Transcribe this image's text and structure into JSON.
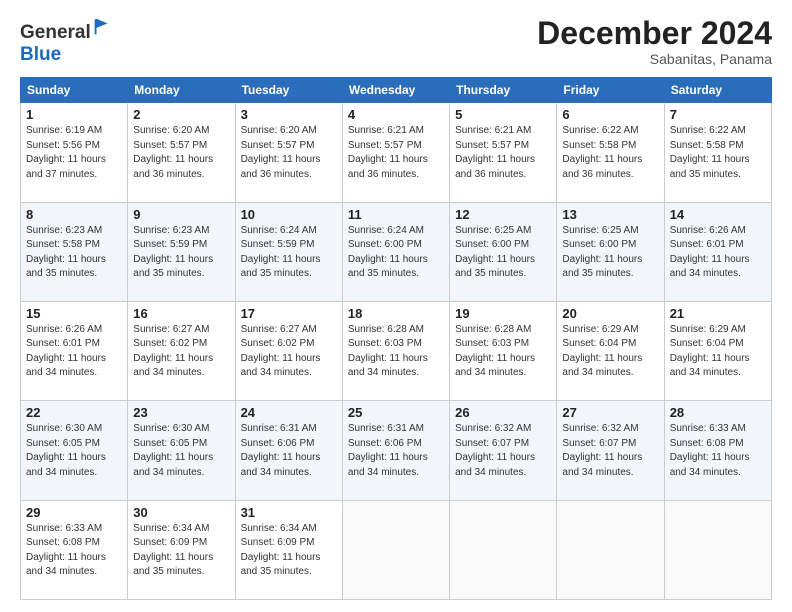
{
  "header": {
    "logo_general": "General",
    "logo_blue": "Blue",
    "month_title": "December 2024",
    "location": "Sabanitas, Panama"
  },
  "weekdays": [
    "Sunday",
    "Monday",
    "Tuesday",
    "Wednesday",
    "Thursday",
    "Friday",
    "Saturday"
  ],
  "weeks": [
    [
      {
        "day": "1",
        "info": "Sunrise: 6:19 AM\nSunset: 5:56 PM\nDaylight: 11 hours\nand 37 minutes."
      },
      {
        "day": "2",
        "info": "Sunrise: 6:20 AM\nSunset: 5:57 PM\nDaylight: 11 hours\nand 36 minutes."
      },
      {
        "day": "3",
        "info": "Sunrise: 6:20 AM\nSunset: 5:57 PM\nDaylight: 11 hours\nand 36 minutes."
      },
      {
        "day": "4",
        "info": "Sunrise: 6:21 AM\nSunset: 5:57 PM\nDaylight: 11 hours\nand 36 minutes."
      },
      {
        "day": "5",
        "info": "Sunrise: 6:21 AM\nSunset: 5:57 PM\nDaylight: 11 hours\nand 36 minutes."
      },
      {
        "day": "6",
        "info": "Sunrise: 6:22 AM\nSunset: 5:58 PM\nDaylight: 11 hours\nand 36 minutes."
      },
      {
        "day": "7",
        "info": "Sunrise: 6:22 AM\nSunset: 5:58 PM\nDaylight: 11 hours\nand 35 minutes."
      }
    ],
    [
      {
        "day": "8",
        "info": "Sunrise: 6:23 AM\nSunset: 5:58 PM\nDaylight: 11 hours\nand 35 minutes."
      },
      {
        "day": "9",
        "info": "Sunrise: 6:23 AM\nSunset: 5:59 PM\nDaylight: 11 hours\nand 35 minutes."
      },
      {
        "day": "10",
        "info": "Sunrise: 6:24 AM\nSunset: 5:59 PM\nDaylight: 11 hours\nand 35 minutes."
      },
      {
        "day": "11",
        "info": "Sunrise: 6:24 AM\nSunset: 6:00 PM\nDaylight: 11 hours\nand 35 minutes."
      },
      {
        "day": "12",
        "info": "Sunrise: 6:25 AM\nSunset: 6:00 PM\nDaylight: 11 hours\nand 35 minutes."
      },
      {
        "day": "13",
        "info": "Sunrise: 6:25 AM\nSunset: 6:00 PM\nDaylight: 11 hours\nand 35 minutes."
      },
      {
        "day": "14",
        "info": "Sunrise: 6:26 AM\nSunset: 6:01 PM\nDaylight: 11 hours\nand 34 minutes."
      }
    ],
    [
      {
        "day": "15",
        "info": "Sunrise: 6:26 AM\nSunset: 6:01 PM\nDaylight: 11 hours\nand 34 minutes."
      },
      {
        "day": "16",
        "info": "Sunrise: 6:27 AM\nSunset: 6:02 PM\nDaylight: 11 hours\nand 34 minutes."
      },
      {
        "day": "17",
        "info": "Sunrise: 6:27 AM\nSunset: 6:02 PM\nDaylight: 11 hours\nand 34 minutes."
      },
      {
        "day": "18",
        "info": "Sunrise: 6:28 AM\nSunset: 6:03 PM\nDaylight: 11 hours\nand 34 minutes."
      },
      {
        "day": "19",
        "info": "Sunrise: 6:28 AM\nSunset: 6:03 PM\nDaylight: 11 hours\nand 34 minutes."
      },
      {
        "day": "20",
        "info": "Sunrise: 6:29 AM\nSunset: 6:04 PM\nDaylight: 11 hours\nand 34 minutes."
      },
      {
        "day": "21",
        "info": "Sunrise: 6:29 AM\nSunset: 6:04 PM\nDaylight: 11 hours\nand 34 minutes."
      }
    ],
    [
      {
        "day": "22",
        "info": "Sunrise: 6:30 AM\nSunset: 6:05 PM\nDaylight: 11 hours\nand 34 minutes."
      },
      {
        "day": "23",
        "info": "Sunrise: 6:30 AM\nSunset: 6:05 PM\nDaylight: 11 hours\nand 34 minutes."
      },
      {
        "day": "24",
        "info": "Sunrise: 6:31 AM\nSunset: 6:06 PM\nDaylight: 11 hours\nand 34 minutes."
      },
      {
        "day": "25",
        "info": "Sunrise: 6:31 AM\nSunset: 6:06 PM\nDaylight: 11 hours\nand 34 minutes."
      },
      {
        "day": "26",
        "info": "Sunrise: 6:32 AM\nSunset: 6:07 PM\nDaylight: 11 hours\nand 34 minutes."
      },
      {
        "day": "27",
        "info": "Sunrise: 6:32 AM\nSunset: 6:07 PM\nDaylight: 11 hours\nand 34 minutes."
      },
      {
        "day": "28",
        "info": "Sunrise: 6:33 AM\nSunset: 6:08 PM\nDaylight: 11 hours\nand 34 minutes."
      }
    ],
    [
      {
        "day": "29",
        "info": "Sunrise: 6:33 AM\nSunset: 6:08 PM\nDaylight: 11 hours\nand 34 minutes."
      },
      {
        "day": "30",
        "info": "Sunrise: 6:34 AM\nSunset: 6:09 PM\nDaylight: 11 hours\nand 35 minutes."
      },
      {
        "day": "31",
        "info": "Sunrise: 6:34 AM\nSunset: 6:09 PM\nDaylight: 11 hours\nand 35 minutes."
      },
      {
        "day": "",
        "info": ""
      },
      {
        "day": "",
        "info": ""
      },
      {
        "day": "",
        "info": ""
      },
      {
        "day": "",
        "info": ""
      }
    ]
  ]
}
